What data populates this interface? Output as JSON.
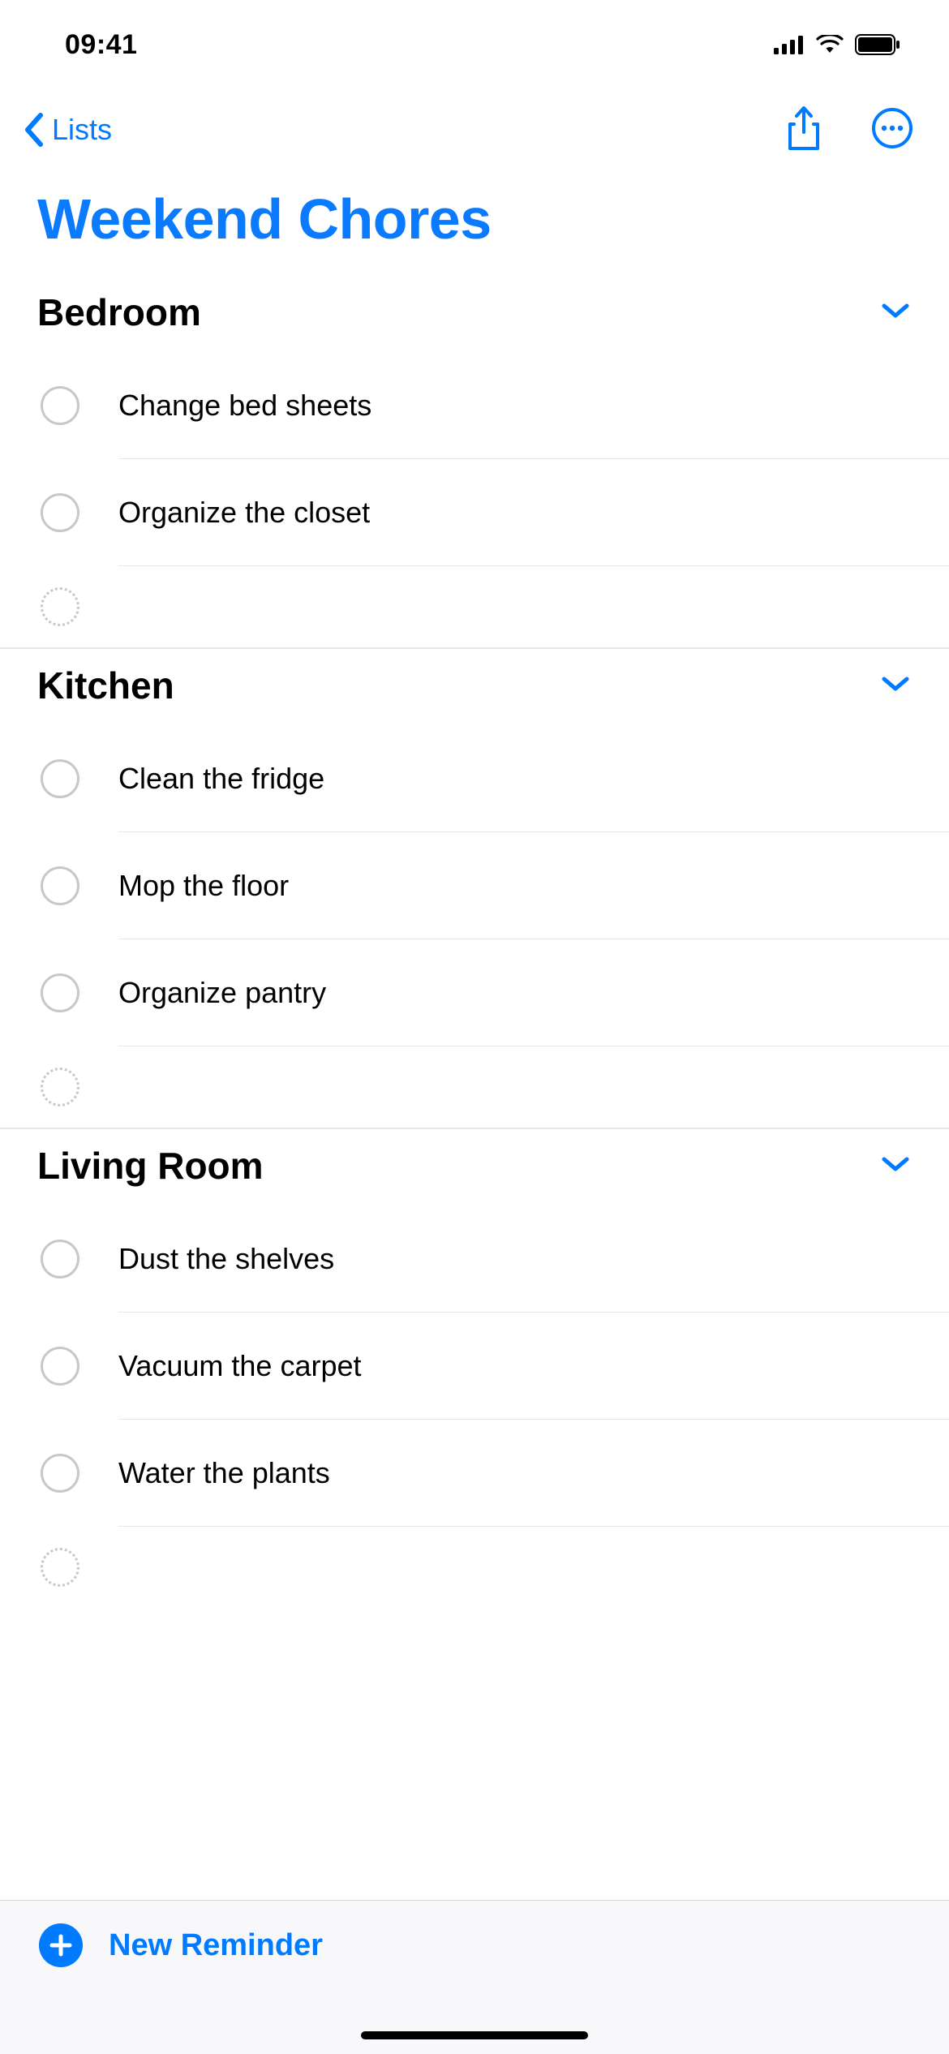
{
  "status": {
    "time": "09:41"
  },
  "nav": {
    "back_label": "Lists"
  },
  "title": "Weekend Chores",
  "sections": [
    {
      "title": "Bedroom",
      "items": [
        "Change bed sheets",
        "Organize the closet"
      ]
    },
    {
      "title": "Kitchen",
      "items": [
        "Clean the fridge",
        "Mop the floor",
        "Organize pantry"
      ]
    },
    {
      "title": "Living Room",
      "items": [
        "Dust the shelves",
        "Vacuum the carpet",
        "Water the plants"
      ]
    }
  ],
  "toolbar": {
    "new_reminder_label": "New Reminder"
  }
}
